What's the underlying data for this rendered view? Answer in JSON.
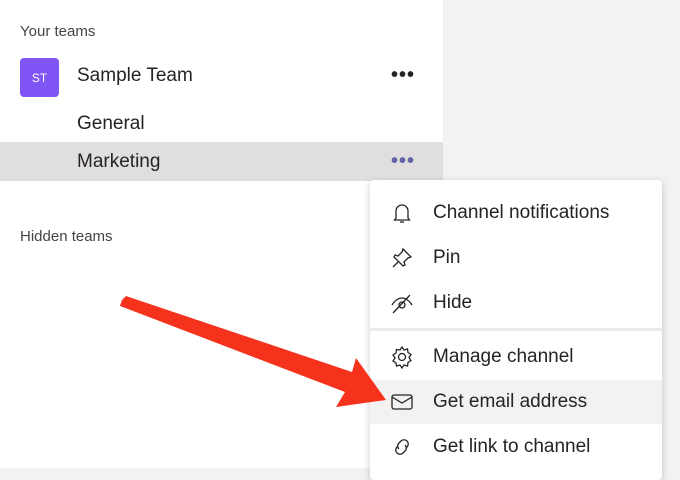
{
  "sidebar": {
    "your_teams": "Your teams",
    "hidden_teams": "Hidden teams",
    "team": {
      "initials": "ST",
      "name": "Sample Team",
      "avatar_color": "#7f56f5"
    },
    "channels": [
      {
        "label": "General"
      },
      {
        "label": "Marketing",
        "selected": true
      }
    ],
    "more": "•••"
  },
  "menu": {
    "items": [
      {
        "icon": "bell-icon",
        "label": "Channel notifications"
      },
      {
        "icon": "pin-icon",
        "label": "Pin"
      },
      {
        "icon": "hide-icon",
        "label": "Hide"
      },
      {
        "icon": "gear-icon",
        "label": "Manage channel"
      },
      {
        "icon": "mail-icon",
        "label": "Get email address",
        "hovered": true
      },
      {
        "icon": "link-icon",
        "label": "Get link to channel"
      }
    ]
  },
  "annotation": {
    "arrow_color": "#f5331d"
  }
}
